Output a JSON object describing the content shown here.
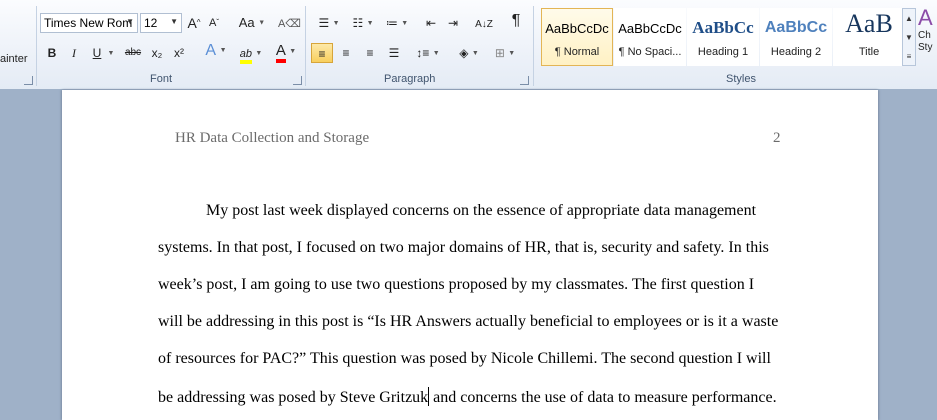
{
  "clipboard": {
    "format_painter_partial": "ainter"
  },
  "font": {
    "name": "Times New Rom",
    "size": "12",
    "grow_label": "A",
    "shrink_label": "A",
    "change_case_label": "Aa",
    "bold": "B",
    "italic": "I",
    "underline": "U",
    "strikethrough": "abc",
    "subscript": "x₂",
    "superscript": "x²",
    "text_effects": "A",
    "highlight": "ab",
    "font_color": "A",
    "highlight_color": "#ffff00",
    "font_color_value": "#ff0000",
    "group_label": "Font"
  },
  "paragraph": {
    "group_label": "Paragraph",
    "pilcrow": "¶"
  },
  "styles": {
    "group_label": "Styles",
    "items": [
      {
        "preview": "AaBbCcDc",
        "name": "¶ Normal",
        "active": true
      },
      {
        "preview": "AaBbCcDc",
        "name": "¶ No Spaci...",
        "active": false
      },
      {
        "preview": "AaBbCс",
        "name": "Heading 1",
        "active": false
      },
      {
        "preview": "AaBbCc",
        "name": "Heading 2",
        "active": false
      },
      {
        "preview": "AaB",
        "name": "Title",
        "active": false
      }
    ],
    "change_styles_partial": "Ch Sty"
  },
  "document": {
    "header_title": "HR Data Collection and Storage",
    "page_number": "2",
    "lines": [
      "My post last week displayed concerns on the essence of appropriate data management",
      "systems. In that post, I focused on two major domains of HR, that is, security and safety. In this",
      "week’s post, I am going to use two questions proposed by my classmates. The first question I",
      "will be addressing in this post is “Is HR Answers actually beneficial to employees or is it a waste",
      "of resources  for PAC?” This question was posed by Nicole Chillemi.  The second question I will",
      "be addressing was posed by Steve Gritzuk",
      " and concerns the use of data to measure performance."
    ]
  }
}
